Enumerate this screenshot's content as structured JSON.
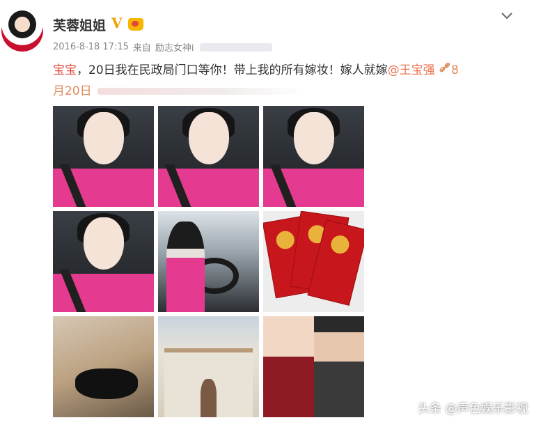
{
  "post": {
    "username": "芙蓉姐姐",
    "verified_badge": "V",
    "date": "2016-8-18 17:15",
    "source_prefix": "来自",
    "source_name": "励志女神i",
    "text": {
      "part1": "宝宝",
      "part2": "，20日我在民政局门口等你！带上我的所有嫁妆！嫁人就嫁",
      "mention": "@王宝强",
      "trail": "8",
      "line2": "月20日"
    }
  },
  "watermark": {
    "text": "头条 @声色娱乐影视"
  },
  "colors": {
    "mention": "#eb7350",
    "highlight": "#e0463a",
    "verified": "#f0a000"
  },
  "icons": {
    "menu": "chevron-down-icon",
    "link": "link-icon"
  },
  "photos": [
    "selfie-photo",
    "selfie-photo",
    "selfie-photo",
    "selfie-photo",
    "driving-photo",
    "marriage-certificates-photo",
    "cards-and-car-key-photo",
    "civil-affairs-building-photo",
    "couple-portrait-photo"
  ]
}
